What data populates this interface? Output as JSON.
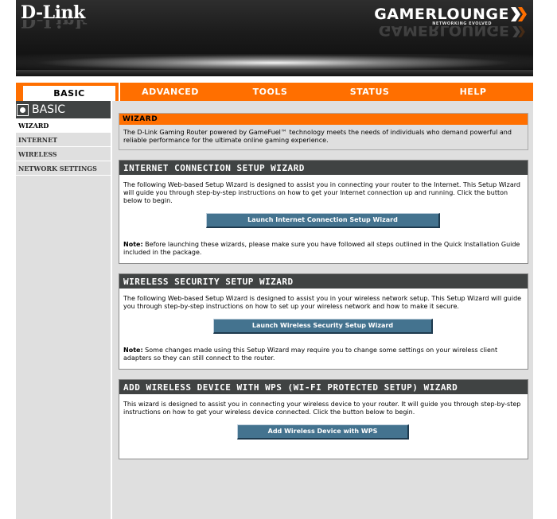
{
  "header": {
    "brand": "D-Link",
    "gamer_logo": "GAMERLOUNGE",
    "gamer_tagline": "NETWORKING EVOLVED"
  },
  "nav": {
    "tabs": [
      {
        "label": "BASIC",
        "active": true
      },
      {
        "label": "ADVANCED",
        "active": false
      },
      {
        "label": "TOOLS",
        "active": false
      },
      {
        "label": "STATUS",
        "active": false
      },
      {
        "label": "HELP",
        "active": false
      }
    ]
  },
  "sidebar": {
    "title": "BASIC",
    "items": [
      "WIZARD",
      "INTERNET",
      "WIRELESS",
      "NETWORK SETTINGS"
    ],
    "selected": "WIZARD"
  },
  "intro": {
    "title": "WIZARD",
    "text": "The D-Link Gaming Router powered by GameFuel™ technology meets the needs of individuals who demand powerful and reliable performance for the ultimate online gaming experience."
  },
  "internet_wizard": {
    "title": "INTERNET CONNECTION SETUP WIZARD",
    "description": "The following Web-based Setup Wizard is designed to assist you in connecting your router to the Internet. This Setup Wizard will guide you through step-by-step instructions on how to get your Internet connection up and running. Click the button below to begin.",
    "button": "Launch Internet Connection Setup Wizard",
    "note_label": "Note:",
    "note_text": " Before launching these wizards, please make sure you have followed all steps outlined in the Quick Installation Guide included in the package."
  },
  "wireless_wizard": {
    "title": "WIRELESS SECURITY SETUP WIZARD",
    "description": "The following Web-based Setup Wizard is designed to assist you in your wireless network setup. This Setup Wizard will guide you through step-by-step instructions on how to set up your wireless network and how to make it secure.",
    "button": "Launch Wireless Security Setup Wizard",
    "note_label": "Note:",
    "note_text": " Some changes made using this Setup Wizard may require you to change some settings on your wireless client adapters so they can still connect to the router."
  },
  "wps_wizard": {
    "title": "ADD WIRELESS DEVICE WITH WPS (WI-FI PROTECTED SETUP) WIZARD",
    "description": "This wizard is designed to assist you in connecting your wireless device to your router. It will guide you through step-by-step instructions on how to get your wireless device connected. Click the button below to begin.",
    "button": "Add Wireless Device with WPS"
  },
  "colors": {
    "orange": "#ff6f00",
    "dark_header": "#404343",
    "button_blue": "#44738f",
    "panel_gray": "#dfdfdf"
  }
}
